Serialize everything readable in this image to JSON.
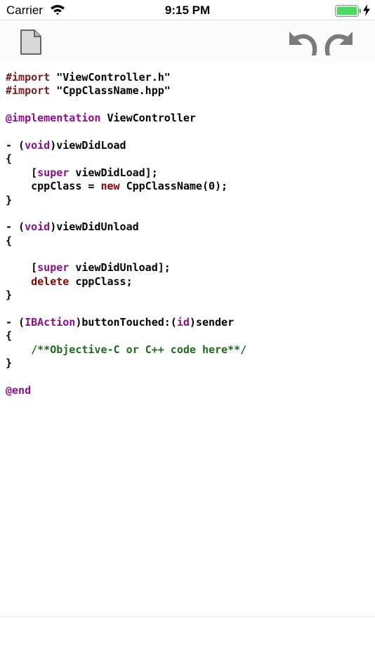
{
  "status_bar": {
    "carrier": "Carrier",
    "time": "9:15 PM",
    "battery_color": "#4cd964"
  },
  "toolbar": {
    "new_file_icon": "document-icon",
    "undo_icon": "undo-icon",
    "redo_icon": "redo-icon",
    "icon_color": "#7b7b7b"
  },
  "code": {
    "l1": {
      "a": "#import",
      "b": " \"ViewController.h\""
    },
    "l2": {
      "a": "#import",
      "b": " \"CppClassName.hpp\""
    },
    "l3": {
      "a": "@implementation",
      "b": " ViewController"
    },
    "l4": {
      "a": "- (",
      "b": "void",
      "c": ")viewDidLoad"
    },
    "l5": {
      "a": "{"
    },
    "l6": {
      "a": "    [",
      "b": "super",
      "c": " viewDidLoad];"
    },
    "l7": {
      "a": "    cppClass = ",
      "b": "new",
      "c": " CppClassName(0);"
    },
    "l8": {
      "a": "}"
    },
    "l9": {
      "a": "- (",
      "b": "void",
      "c": ")viewDidUnload"
    },
    "l10": {
      "a": "{"
    },
    "l11": {
      "a": "    [",
      "b": "super",
      "c": " viewDidUnload];"
    },
    "l12": {
      "a": "    ",
      "b": "delete",
      "c": " cppClass;"
    },
    "l13": {
      "a": "}"
    },
    "l14": {
      "a": "- (",
      "b": "IBAction",
      "c": ")buttonTouched:(",
      "d": "id",
      "e": ")sender"
    },
    "l15": {
      "a": "{"
    },
    "l16": {
      "a": "    /**Objective-C or C++ code here**/"
    },
    "l17": {
      "a": "}"
    },
    "l18": {
      "a": "@end"
    }
  }
}
